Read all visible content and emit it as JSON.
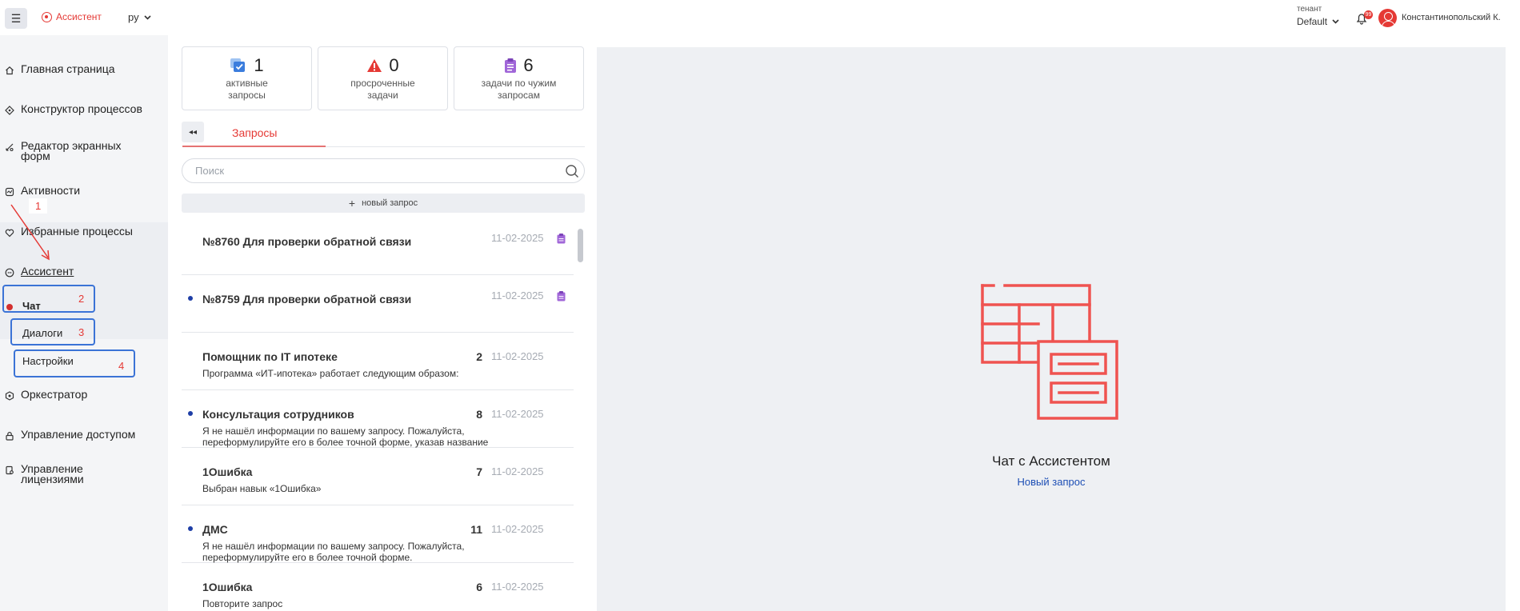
{
  "header": {
    "menu_icon": "☰",
    "brand": "Ассистент",
    "lang": "ру",
    "tenant_label": "тенант",
    "tenant_value": "Default",
    "notification_count": "99",
    "username": "Константинопольский К."
  },
  "sidebar": {
    "items": [
      {
        "label": "Главная страница",
        "icon": "home-icon"
      },
      {
        "label": "Конструктор процессов",
        "icon": "process-icon"
      },
      {
        "label": "Редактор экранных форм",
        "icon": "form-editor-icon"
      },
      {
        "label": "Активности",
        "icon": "activity-icon"
      },
      {
        "label": "Избранные процессы",
        "icon": "heart-icon"
      },
      {
        "label": "Ассистент",
        "icon": "assistant-icon"
      },
      {
        "label": "Оркестратор",
        "icon": "orchestrator-icon"
      },
      {
        "label": "Управление доступом",
        "icon": "lock-icon"
      },
      {
        "label": "Управление лицензиями",
        "icon": "license-icon"
      }
    ],
    "assistant_sub": [
      "Чат",
      "Диалоги",
      "Настройки"
    ]
  },
  "annotations": [
    "1",
    "2",
    "3",
    "4"
  ],
  "stats": [
    {
      "value": "1",
      "label": "активные запросы",
      "icon": "stack-check-icon",
      "color": "#3b7ddd"
    },
    {
      "value": "0",
      "label": "просроченные задачи",
      "icon": "warning-icon",
      "color": "#e53935"
    },
    {
      "value": "6",
      "label": "задачи по чужим запросам",
      "icon": "clipboard-icon",
      "color": "#a066d8"
    }
  ],
  "tabs": {
    "collapse": "◂◂",
    "requests": "Запросы"
  },
  "search": {
    "placeholder": "Поиск"
  },
  "new_request": {
    "plus": "+",
    "label": "новый запрос"
  },
  "requests": [
    {
      "title": "№8760 Для проверки обратной связи",
      "date": "11-02-2025",
      "count": "",
      "snippet": "",
      "unread": false,
      "clip": true
    },
    {
      "title": "№8759 Для проверки обратной связи",
      "date": "11-02-2025",
      "count": "",
      "snippet": "",
      "unread": true,
      "clip": true
    },
    {
      "title": "Помощник по IT ипотеке",
      "date": "11-02-2025",
      "count": "2",
      "snippet": "Программа «ИТ-ипотека» работает следующим образом:",
      "unread": false,
      "clip": false
    },
    {
      "title": "Консультация сотрудников",
      "date": "11-02-2025",
      "count": "8",
      "snippet": "Я не нашёл информации по вашему запросу. Пожалуйста, переформулируйте его в более точной форме, указав название",
      "unread": true,
      "clip": false
    },
    {
      "title": "1Ошибка",
      "date": "11-02-2025",
      "count": "7",
      "snippet": "Выбран навык «1Ошибка»",
      "unread": false,
      "clip": false
    },
    {
      "title": "ДМС",
      "date": "11-02-2025",
      "count": "11",
      "snippet": "Я не нашёл информации по вашему запросу. Пожалуйста, переформулируйте его в более точной форме.",
      "unread": true,
      "clip": false
    },
    {
      "title": "1Ошибка",
      "date": "11-02-2025",
      "count": "6",
      "snippet": "Повторите запрос",
      "unread": false,
      "clip": false
    }
  ],
  "chat": {
    "title": "Чат с Ассистентом",
    "new_request": "Новый запрос"
  },
  "colors": {
    "accent": "#e53935",
    "link": "#1e4fb5",
    "unread_dot": "#1e3ea6",
    "illustration": "#ef5350"
  }
}
